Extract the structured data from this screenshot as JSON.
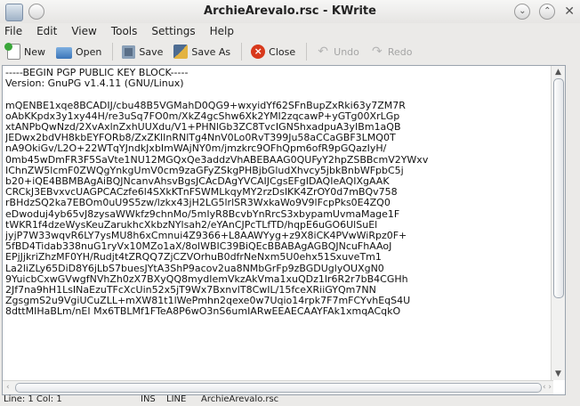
{
  "window": {
    "title": "ArchieArevalo.rsc - KWrite",
    "close_glyph": "✕",
    "minimize_glyph": "⌄",
    "maximize_glyph": "⌃"
  },
  "menu": [
    "File",
    "Edit",
    "View",
    "Tools",
    "Settings",
    "Help"
  ],
  "toolbar": {
    "new": "New",
    "open": "Open",
    "save": "Save",
    "save_as": "Save As",
    "close": "Close",
    "undo": "Undo",
    "redo": "Redo"
  },
  "editor": {
    "lines": [
      "-----BEGIN PGP PUBLIC KEY BLOCK-----",
      "Version: GnuPG v1.4.11 (GNU/Linux)",
      "",
      "mQENBE1xqe8BCADIJ/cbu48B5VGMahD0QG9+wxyidYf62SFnBupZxRki63y7ZM7R",
      "oAbKKpdx3y1xy44H/re3uSq7FO0m/XkZ4gcShw6Xk2YMI2zqcawP+yGTg00XrLGp",
      "xtANPbQwNzd/2XvAxlnZxhUUXdu/V1+PHNlGb3ZC8TvcIGNShxadpuA3yIBm1aQB",
      "JEDwx2bdVH8kbEYFORb8/ZxZKlInRNlTg4NnV0Lo0RvT399Ju58aCCaGBF3LMQ0T",
      "nA9OkiGv/L2O+22WTqYJndkJxbImWAjNY0m/jmzkrc9OFhQpm6ofR9pGQazIyH/",
      "0mb45wDmFR3F5SaVte1NU12MGQxQe3addzVhABEBAAG0QUFyY2hpZSBBcmV2YWxv",
      "IChnZW5lcmF0ZWQgYnkgUmV0cm9zaGFyZSkgPHBjbGludXhvcy5jbkBnbWFpbC5j",
      "b20+iQE4BBMBAgAiBQJNcanvAhsvBgsJCAcDAgYVCAIJCgsEFgIDAQIeAQIXgAAK",
      "CRCkJ3EBvxvcUAGPCACzfe6l4SXkKTnFSWMLkqyMY2rzDslKK4ZrOY0d7mBQv758",
      "rBHdzSQ2ka7EBOm0uU9S5zw/lzkx43jH2LG5lrlSR3WxkaWo9V9lFcpPks0E4ZQ0",
      "eDwoduj4yb65vJ8zysaWWkfz9chnMo/5mIyR8BcvbYnRrcS3xbypamUvmaMage1F",
      "tWKR1f4dzeWysKeuZarukhcXkbzNYlsah2/eYAnCJPcTLfTD/hqpE6uGO6UlSuEl",
      "jyjP7W33wqvR6LY7ysMU8h6xCmnui4Z9366+L8AAWYyg+z9X8iCK4PVwWiRpz0F+",
      "5fBD4Tidab338nuG1ryVx10MZo1aX/8olWBIC39BiQEcBBABAgAGBQJNcuFhAAoJ",
      "EPjJjkriZhzMF0YH/Rudjt4tZRQQ7ZjCZVOrhuB0dfrNeNxm5U0ehx51SxuveTm1",
      "La2liZLy65DiD8Y6jLbS7buesJYtA3ShP9acov2ua8NMbGrFp9zBGDUglyOUXgN0",
      "9YuicbCxwGVwgfNVhZh0zX7BXyQQ8mydIemVkzAkVma1xuQDz1lr6R2r7bB4CGHh",
      "2Jf7na9hH1LsINaEzuTFcXcUin52x5jT9Wx7BxnvlT8CwIL/15fceXRiiGYQm7NN",
      "ZgsgmS2u9VgiUCuZLL+mXW81t1lWePmhn2qexe0w7Uqio14rpk7F7mFCYvhEqS4U",
      "8dttMIHaBLm/nEI Mx6TBLMf1FTeA8P6wO3nS6umIARwEEAECAAYFAk1xmqACqkO"
    ]
  },
  "status": {
    "position": "Line: 1 Col: 1",
    "mode": "INS",
    "selection": "LINE",
    "filename": "ArchieArevalo.rsc"
  }
}
